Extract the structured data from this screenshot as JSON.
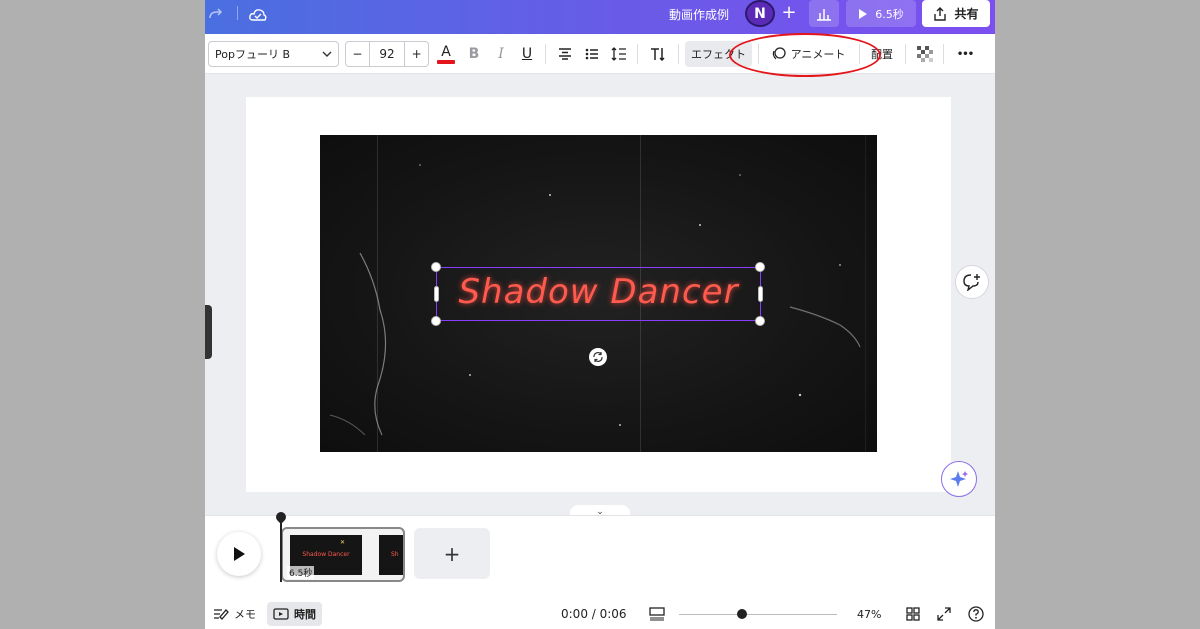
{
  "topbar": {
    "title": "動画作成例",
    "avatar_initial": "N",
    "add_label": "+",
    "present_label": "6.5秒",
    "share_label": "共有"
  },
  "toolbar": {
    "font_name": "Popフューリ B",
    "size_minus": "−",
    "font_size": "92",
    "size_plus": "+",
    "text_color_letter": "A",
    "text_color": "#e4151b",
    "bold": "B",
    "italic": "I",
    "underline": "U",
    "effect_label": "エフェクト",
    "animate_label": "アニメート",
    "position_label": "配置",
    "more_label": "•••"
  },
  "canvas": {
    "headline": "Shadow Dancer",
    "headline_color": "#ff5a4e",
    "selection_color": "#8b3dff"
  },
  "timeline": {
    "clip_duration": "6.5秒",
    "thumb_text": "Shadow Dancer",
    "thumb_text_short": "Sh",
    "add_clip": "+"
  },
  "bottombar": {
    "notes_label": "メモ",
    "time_label": "時間",
    "time_readout": "0:00 / 0:06",
    "zoom_level": "47%"
  },
  "annotation_color": "#e4151b"
}
